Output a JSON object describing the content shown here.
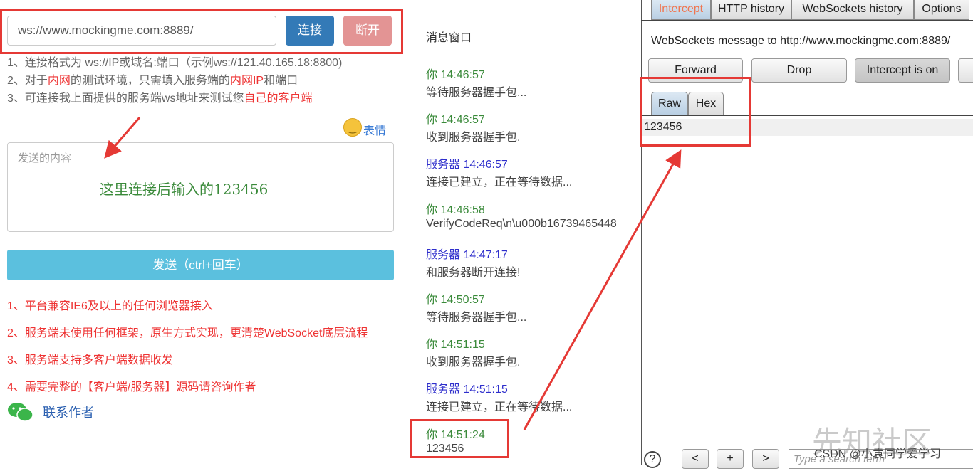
{
  "client": {
    "url_value": "ws://www.mockingme.com:8889/",
    "connect_label": "连接",
    "disconnect_label": "断开",
    "tips": [
      [
        "1、连接格式为 ws://IP或域名:端口（示例ws://121.40.165.18:8800)"
      ],
      [
        "2、对于",
        "内网",
        "的测试环境，只需填入服务端的",
        "内网IP",
        "和端口"
      ],
      [
        "3、可连接我上面提供的服务端ws地址来测试您",
        "自己的客户端"
      ]
    ],
    "emoji_label": "表情",
    "input_placeholder": "发送的内容",
    "annotation": "这里连接后输入的123456",
    "send_label": "发送（ctrl+回车）",
    "features": [
      "1、平台兼容IE6及以上的任何浏览器接入",
      "2、服务端未使用任何框架，原生方式实现，更清楚WebSocket底层流程",
      "3、服务端支持多客户端数据收发",
      "4、需要完整的【客户端/服务器】源码请咨询作者"
    ],
    "contact_label": "联系作者"
  },
  "messages": {
    "title": "消息窗口",
    "items": [
      {
        "sender": "你",
        "time": "14:46:57",
        "text": "等待服务器握手包...",
        "type": "you"
      },
      {
        "sender": "你",
        "time": "14:46:57",
        "text": "收到服务器握手包.",
        "type": "you"
      },
      {
        "sender": "服务器",
        "time": "14:46:57",
        "text": "连接已建立，正在等待数据...",
        "type": "srv"
      },
      {
        "sender": "你",
        "time": "14:46:58",
        "text": "VerifyCodeReq\\n\\u000b16739465448",
        "type": "you"
      },
      {
        "sender": "服务器",
        "time": "14:47:17",
        "text": "和服务器断开连接!",
        "type": "srv"
      },
      {
        "sender": "你",
        "time": "14:50:57",
        "text": "等待服务器握手包...",
        "type": "you"
      },
      {
        "sender": "你",
        "time": "14:51:15",
        "text": "收到服务器握手包.",
        "type": "you"
      },
      {
        "sender": "服务器",
        "time": "14:51:15",
        "text": "连接已建立，正在等待数据...",
        "type": "srv"
      },
      {
        "sender": "你",
        "time": "14:51:24",
        "text": "123456",
        "type": "you"
      }
    ]
  },
  "burp": {
    "tabs": [
      "Intercept",
      "HTTP history",
      "WebSockets history",
      "Options"
    ],
    "ws_message": "WebSockets message to http://www.mockingme.com:8889/",
    "forward_label": "Forward",
    "drop_label": "Drop",
    "intercept_label": "Intercept is on",
    "subtabs": [
      "Raw",
      "Hex"
    ],
    "payload": "123456",
    "nav": [
      "<",
      "+",
      ">"
    ],
    "search_placeholder": "Type a search term"
  },
  "watermark": {
    "site": "先知社区",
    "credit": "CSDN @小袁同学爱学习"
  },
  "colors": {
    "annotation_red": "#e53935",
    "connect": "#337ab7",
    "send": "#5bc0de",
    "you": "#3a8a3a",
    "server": "#2e2ecc"
  }
}
